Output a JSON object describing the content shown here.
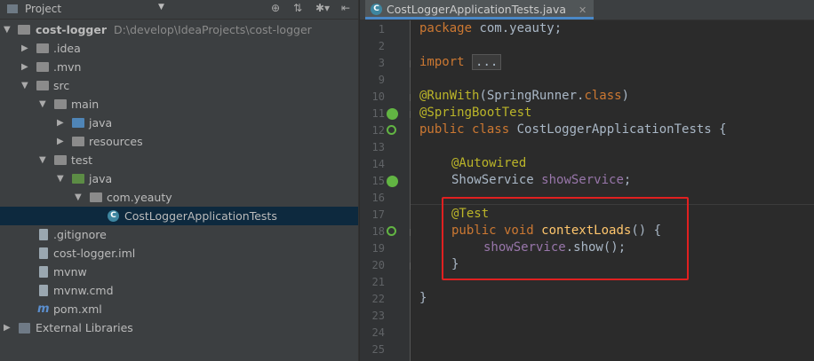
{
  "project_panel": {
    "title": "Project",
    "tree": [
      {
        "label": "cost-logger",
        "path": "D:\\develop\\IdeaProjects\\cost-logger"
      },
      {
        "label": ".idea"
      },
      {
        "label": ".mvn"
      },
      {
        "label": "src"
      },
      {
        "label": "main"
      },
      {
        "label": "java"
      },
      {
        "label": "resources"
      },
      {
        "label": "test"
      },
      {
        "label": "java"
      },
      {
        "label": "com.yeauty"
      },
      {
        "label": "CostLoggerApplicationTests"
      },
      {
        "label": ".gitignore"
      },
      {
        "label": "cost-logger.iml"
      },
      {
        "label": "mvnw"
      },
      {
        "label": "mvnw.cmd"
      },
      {
        "label": "pom.xml"
      },
      {
        "label": "External Libraries"
      }
    ]
  },
  "editor": {
    "tab_title": "CostLoggerApplicationTests.java",
    "line_numbers": [
      "1",
      "2",
      "3",
      "9",
      "10",
      "11",
      "12",
      "13",
      "14",
      "15",
      "16",
      "17",
      "18",
      "19",
      "20",
      "21",
      "22",
      "23",
      "24",
      "25"
    ],
    "code": {
      "l1_kw": "package",
      "l1_rest": " com.yeauty;",
      "l3_kw": "import",
      "l3_fold": "...",
      "l10_an": "@RunWith",
      "l10_a": "(SpringRunner.",
      "l10_kw": "class",
      "l10_b": ")",
      "l11_an": "@SpringBootTest",
      "l12_kw": "public class",
      "l12_rest": " CostLoggerApplicationTests {",
      "l14_an": "@Autowired",
      "l15_type": "ShowService ",
      "l15_field": "showService",
      "l15_end": ";",
      "l17_an": "@Test",
      "l18_kw": "public void",
      "l18_fn": "contextLoads",
      "l18_rest": "() {",
      "l19_field": "showService",
      "l19_rest": ".show();",
      "l20": "}",
      "l22": "}"
    }
  },
  "colors": {
    "highlight_box": "#e02020",
    "selection": "#0d293e"
  }
}
